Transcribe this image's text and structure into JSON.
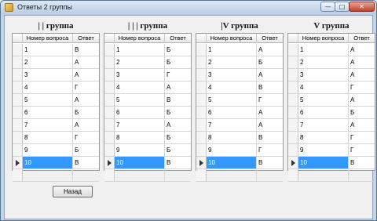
{
  "window": {
    "title": "Ответы 2 группы",
    "buttons": {
      "minimize": "—",
      "maximize": "□",
      "close": "✕"
    }
  },
  "columns": {
    "question": "Номер вопроса",
    "answer": "Ответ"
  },
  "groups": [
    {
      "title": "| | группа",
      "rows": [
        {
          "q": "1",
          "a": "В"
        },
        {
          "q": "2",
          "a": "А"
        },
        {
          "q": "3",
          "a": "А"
        },
        {
          "q": "4",
          "a": "Г"
        },
        {
          "q": "5",
          "a": "А"
        },
        {
          "q": "6",
          "a": "Б"
        },
        {
          "q": "7",
          "a": "А"
        },
        {
          "q": "8",
          "a": "Г"
        },
        {
          "q": "9",
          "a": "Б"
        },
        {
          "q": "10",
          "a": "В"
        },
        {
          "q": "",
          "a": ""
        }
      ]
    },
    {
      "title": "| | | группа",
      "rows": [
        {
          "q": "1",
          "a": "Б"
        },
        {
          "q": "2",
          "a": "Б"
        },
        {
          "q": "3",
          "a": "Г"
        },
        {
          "q": "4",
          "a": "А"
        },
        {
          "q": "5",
          "a": "В"
        },
        {
          "q": "6",
          "a": "Б"
        },
        {
          "q": "7",
          "a": "А"
        },
        {
          "q": "8",
          "a": "Б"
        },
        {
          "q": "9",
          "a": "Б"
        },
        {
          "q": "10",
          "a": "В"
        },
        {
          "q": "",
          "a": ""
        }
      ]
    },
    {
      "title": "|V группа",
      "rows": [
        {
          "q": "1",
          "a": "А"
        },
        {
          "q": "2",
          "a": "Б"
        },
        {
          "q": "3",
          "a": "А"
        },
        {
          "q": "4",
          "a": "В"
        },
        {
          "q": "5",
          "a": "Г"
        },
        {
          "q": "6",
          "a": "А"
        },
        {
          "q": "7",
          "a": "А"
        },
        {
          "q": "8",
          "a": "В"
        },
        {
          "q": "9",
          "a": "Г"
        },
        {
          "q": "10",
          "a": "В"
        },
        {
          "q": "",
          "a": ""
        }
      ]
    },
    {
      "title": "V группа",
      "rows": [
        {
          "q": "1",
          "a": "А"
        },
        {
          "q": "2",
          "a": "А"
        },
        {
          "q": "3",
          "a": "А"
        },
        {
          "q": "4",
          "a": "Г"
        },
        {
          "q": "5",
          "a": "А"
        },
        {
          "q": "6",
          "a": "Б"
        },
        {
          "q": "7",
          "a": "А"
        },
        {
          "q": "8",
          "a": "Г"
        },
        {
          "q": "9",
          "a": "Г"
        },
        {
          "q": "10",
          "a": "В"
        },
        {
          "q": "",
          "a": ""
        }
      ]
    }
  ],
  "selected_row": "10",
  "back_button": "Назад",
  "colors": {
    "selection": "#3399ff",
    "window_frame": "#c3d3e6",
    "close_button": "#c2402a"
  }
}
